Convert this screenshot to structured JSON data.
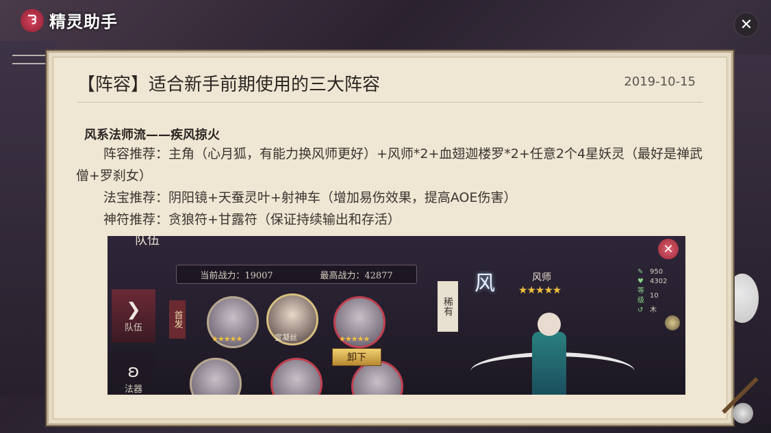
{
  "app": {
    "title": "精灵助手",
    "logo_glyph": "ᘊ"
  },
  "window": {
    "close_label": "✕"
  },
  "article": {
    "title": "【阵容】适合新手前期使用的三大阵容",
    "date": "2019-10-15",
    "section_heading": "风系法师流——疾风掠火",
    "para1": "阵容推荐：主角（心月狐，有能力换风师更好）+风师*2+血翅迦楼罗*2+任意2个4星妖灵（最好是禅武僧+罗刹女）",
    "para2": "法宝推荐：阴阳镜+天蚕灵叶+射神车（增加易伤效果，提高AOE伤害）",
    "para3": "神符推荐：贪狼符+甘露符（保证持续输出和存活）"
  },
  "game_screenshot": {
    "banner": "队伍",
    "close_label": "✕",
    "current_power_label": "当前战力：19007",
    "max_power_label": "最高战力：42877",
    "tab_team": "队伍",
    "tab_team_icon": "❯",
    "tab_artifact": "法器",
    "tab_artifact_icon": "ʚ",
    "first_tag": "首发",
    "hero_name": "宣凝丝",
    "stars_hero1": "★★★★★",
    "stars_hero3": "★★★★★",
    "unload_button": "卸下",
    "banner_vertical": "稀有",
    "element_glyph": "风",
    "char_name": "风师",
    "char_stars": "★★★★★",
    "stats": [
      {
        "key": "✎",
        "value": "950"
      },
      {
        "key": "♥",
        "value": "4302"
      },
      {
        "key": "等级",
        "value": "10"
      },
      {
        "key": "↺",
        "value": "木"
      }
    ]
  }
}
